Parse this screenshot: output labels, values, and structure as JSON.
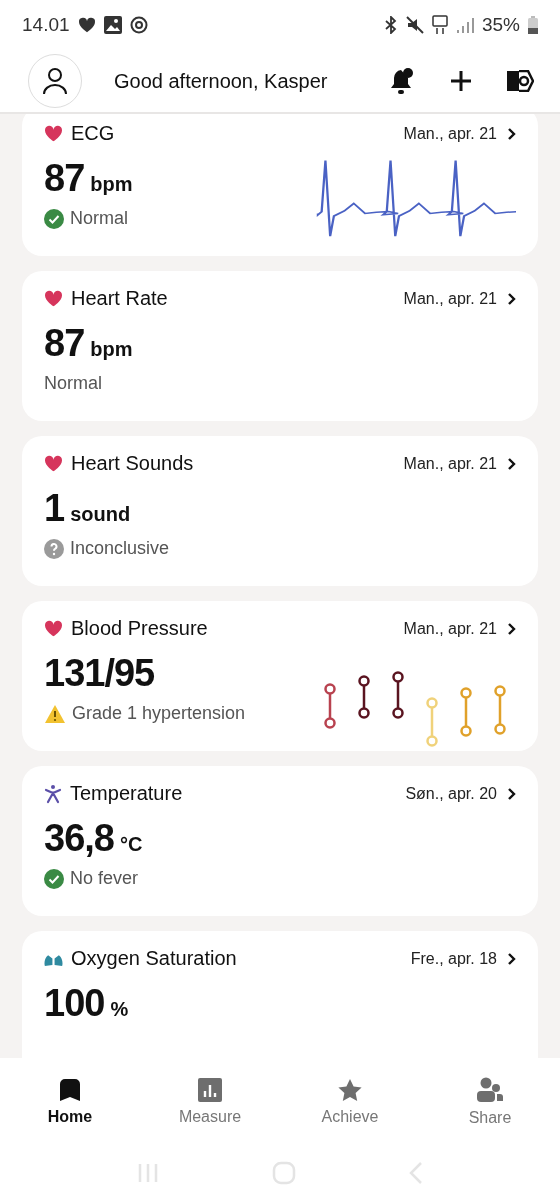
{
  "status_bar": {
    "time": "14.01",
    "battery": "35%"
  },
  "header": {
    "greeting": "Good afternoon, Kasper"
  },
  "cards": [
    {
      "kind": "ecg",
      "title": "ECG",
      "date": "Man., apr. 21",
      "value": "87",
      "unit": "bpm",
      "status": {
        "kind": "ok",
        "text": "Normal"
      }
    },
    {
      "kind": "heart",
      "title": "Heart Rate",
      "date": "Man., apr. 21",
      "value": "87",
      "unit": "bpm",
      "status": {
        "kind": "plain",
        "text": "Normal"
      }
    },
    {
      "kind": "heart",
      "title": "Heart Sounds",
      "date": "Man., apr. 21",
      "value": "1",
      "unit": "sound",
      "status": {
        "kind": "unknown",
        "text": "Inconclusive"
      }
    },
    {
      "kind": "pressure",
      "title": "Blood Pressure",
      "date": "Man., apr. 21",
      "value": "131/95",
      "status": {
        "kind": "warning",
        "text": "Grade 1 hypertension"
      }
    },
    {
      "kind": "temperature",
      "title": "Temperature",
      "date": "Søn., apr. 20",
      "value": "36,8",
      "unit": "°C",
      "status": {
        "kind": "ok",
        "text": "No fever"
      }
    },
    {
      "kind": "oxygen",
      "title": "Oxygen Saturation",
      "date": "Fre., apr. 18",
      "value": "100",
      "unit": "%"
    }
  ],
  "nav": [
    {
      "label": "Home",
      "selected": true
    },
    {
      "label": "Measure",
      "selected": false
    },
    {
      "label": "Achieve",
      "selected": false
    },
    {
      "label": "Share",
      "selected": false
    }
  ]
}
